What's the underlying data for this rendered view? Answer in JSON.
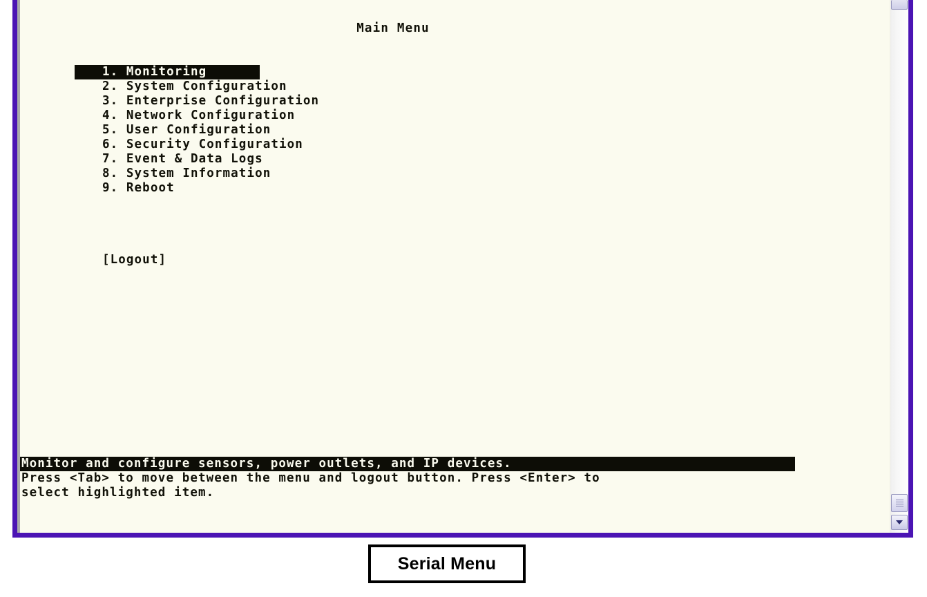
{
  "figure": {
    "caption": "Serial Menu"
  },
  "terminal": {
    "title": "Main Menu",
    "colors": {
      "frame": "#4b14b4",
      "screen_background": "#fbfbef",
      "text": "#111108",
      "highlight_background": "#0d0d06",
      "highlight_text": "#fbfbef"
    },
    "menu": {
      "selected_index": 0,
      "items": [
        {
          "number": "1.",
          "label": "Monitoring",
          "text": "1. Monitoring"
        },
        {
          "number": "2.",
          "label": "System Configuration",
          "text": "2. System Configuration"
        },
        {
          "number": "3.",
          "label": "Enterprise Configuration",
          "text": "3. Enterprise Configuration"
        },
        {
          "number": "4.",
          "label": "Network Configuration",
          "text": "4. Network Configuration"
        },
        {
          "number": "5.",
          "label": "User Configuration",
          "text": "5. User Configuration"
        },
        {
          "number": "6.",
          "label": "Security Configuration",
          "text": "6. Security Configuration"
        },
        {
          "number": "7.",
          "label": "Event & Data Logs",
          "text": "7. Event & Data Logs"
        },
        {
          "number": "8.",
          "label": "System Information",
          "text": "8. System Information"
        },
        {
          "number": "9.",
          "label": "Reboot",
          "text": "9. Reboot"
        }
      ]
    },
    "logout_button": "[Logout]",
    "status": {
      "line1": "Monitor and configure sensors, power outlets, and IP devices.",
      "line2": "Press <Tab> to move between the menu and logout button. Press <Enter> to",
      "line3": "select highlighted item."
    },
    "scrollbar": {
      "up_arrow": "scroll-up-icon",
      "down_arrow": "scroll-down-icon",
      "thumb": "scroll-thumb"
    }
  }
}
